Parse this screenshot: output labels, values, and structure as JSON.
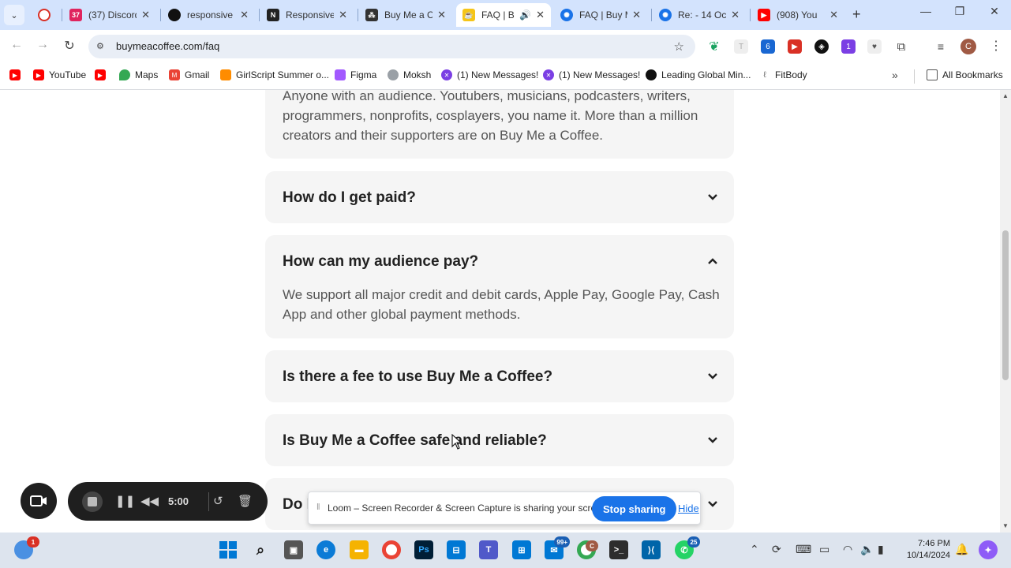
{
  "browser": {
    "tabs": [
      {
        "title": "",
        "favicon": "recording-icon",
        "color": "#d93025"
      },
      {
        "title": "(37) Discord",
        "favicon": "discord-icon",
        "color": "#e0245e"
      },
      {
        "title": "responsive",
        "favicon": "github-icon",
        "color": "#111111"
      },
      {
        "title": "Responsive",
        "favicon": "notion-icon",
        "color": "#222222"
      },
      {
        "title": "Buy Me a C",
        "favicon": "figma-icon",
        "color": "#333333"
      },
      {
        "title": "FAQ | B",
        "favicon": "coffee-icon",
        "color": "#f5c518",
        "active": true
      },
      {
        "title": "FAQ | Buy M",
        "favicon": "atom-icon",
        "color": "#1a73e8"
      },
      {
        "title": "Re: - 14 Oc",
        "favicon": "atom-icon",
        "color": "#1a73e8"
      },
      {
        "title": "(908) You",
        "favicon": "youtube-icon",
        "color": "#ff0000"
      }
    ],
    "url": "buymeacoffee.com/faq",
    "bookmarks": [
      {
        "label": "",
        "icon": "youtube-icon",
        "color": "#ff0000"
      },
      {
        "label": "YouTube",
        "icon": "youtube-icon",
        "color": "#ff0000"
      },
      {
        "label": "",
        "icon": "youtube-icon",
        "color": "#ff0000"
      },
      {
        "label": "Maps",
        "icon": "maps-icon",
        "color": "#34a853"
      },
      {
        "label": "Gmail",
        "icon": "gmail-icon",
        "color": "#ea4335"
      },
      {
        "label": "GirlScript Summer o...",
        "icon": "girlscript-icon",
        "color": "#ff8c00"
      },
      {
        "label": "Figma",
        "icon": "figma-icon",
        "color": "#a259ff"
      },
      {
        "label": "Moksh",
        "icon": "moksh-icon",
        "color": "#9aa0a6"
      },
      {
        "label": "(1) New Messages!",
        "icon": "messages-icon",
        "color": "#7b3fe4"
      },
      {
        "label": "(1) New Messages!",
        "icon": "messages-icon",
        "color": "#7b3fe4"
      },
      {
        "label": "Leading Global Min...",
        "icon": "globe-icon",
        "color": "#111111"
      },
      {
        "label": "FitBody",
        "icon": "fitbody-icon",
        "color": "#777777"
      }
    ],
    "all_bookmarks_label": "All Bookmarks",
    "profile_initial": "C"
  },
  "faq": {
    "intro_answer": "Anyone with an audience. Youtubers, musicians, podcasters, writers, programmers, nonprofits, cosplayers, you name it. More than a million creators and their supporters are on Buy Me a Coffee.",
    "items": [
      {
        "question": "How do I get paid?",
        "expanded": false
      },
      {
        "question": "How can my audience pay?",
        "expanded": true,
        "answer": "We support all major credit and debit cards, Apple Pay, Google Pay, Cash App and other global payment methods."
      },
      {
        "question": "Is there a fee to use Buy Me a Coffee?",
        "expanded": false
      },
      {
        "question": "Is Buy Me a Coffee safe and reliable?",
        "expanded": false
      },
      {
        "question": "Do I",
        "expanded": false
      }
    ]
  },
  "loom": {
    "timer": "5:00",
    "share_message": "Loom – Screen Recorder & Screen Capture is sharing your screen.",
    "stop_label": "Stop sharing",
    "hide_label": "Hide"
  },
  "taskbar": {
    "time": "7:46 PM",
    "date": "10/14/2024",
    "weather_badge": "1",
    "mail_badge": "99+",
    "chrome_badge": "C",
    "whatsapp_badge": "25"
  },
  "colors": {
    "tab_strip": "#d3e3fd",
    "accent_blue": "#1a73e8",
    "card_bg": "#f5f5f5",
    "loom_dark": "#1f1f1f"
  }
}
